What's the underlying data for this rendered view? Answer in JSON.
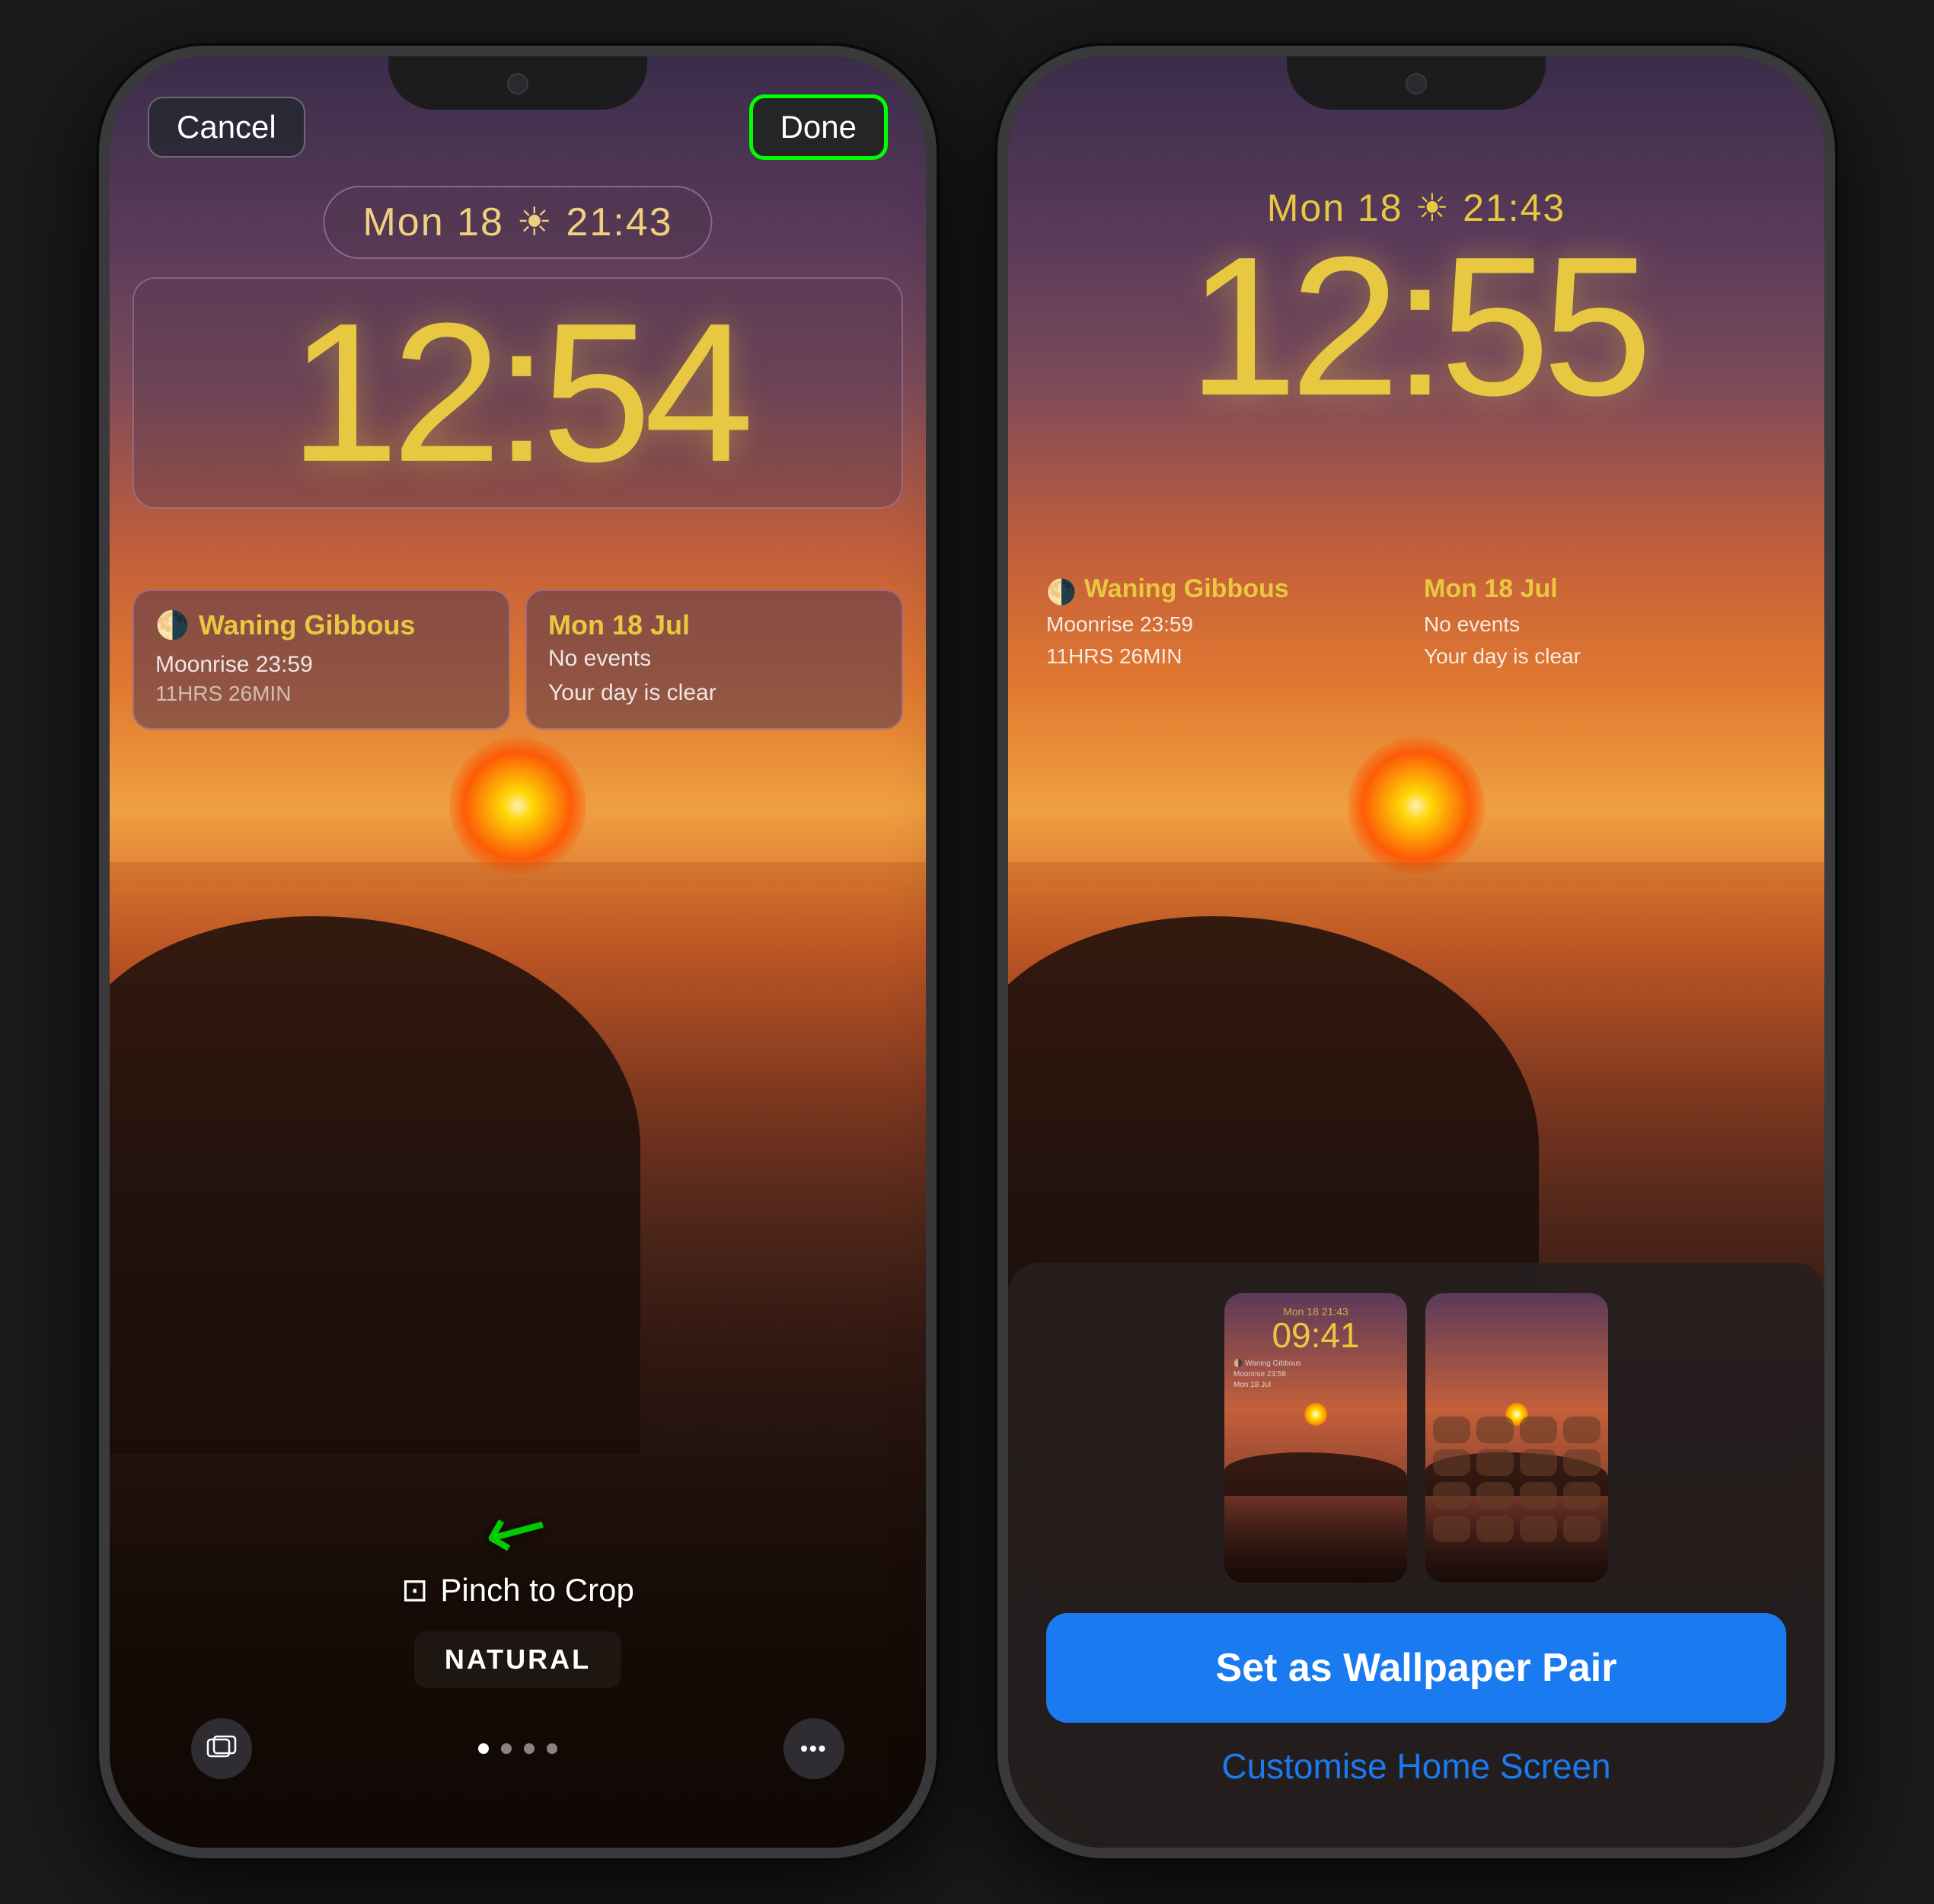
{
  "phone1": {
    "cancel_label": "Cancel",
    "done_label": "Done",
    "date_time": "Mon 18  ☀  21:43",
    "clock": "12:54",
    "widget1": {
      "title": "Waning Gibbous",
      "line1": "Moonrise 23:59",
      "line2": "11HRS 26MIN"
    },
    "widget2": {
      "title": "Mon 18 Jul",
      "line1": "No events",
      "line2": "Your day is clear"
    },
    "pinch_hint": "Pinch to Crop",
    "natural_label": "NATURAL",
    "dots_count": 4,
    "active_dot": 0
  },
  "phone2": {
    "date_time": "Mon 18  ☀  21:43",
    "clock": "12:55",
    "widget1": {
      "title": "Waning Gibbous",
      "line1": "Moonrise 23:59",
      "line2": "11HRS 26MIN"
    },
    "widget2": {
      "title": "Mon 18 Jul",
      "line1": "No events",
      "line2": "Your day is clear"
    },
    "set_wallpaper_label": "Set as Wallpaper Pair",
    "customise_label": "Customise Home Screen",
    "pair_preview": {
      "lock_clock": "09:41",
      "lock_date": "Mon 18  21:43"
    }
  },
  "icons": {
    "crop": "⊡",
    "gallery": "🖼",
    "more": "•••",
    "moon": "🌗"
  }
}
